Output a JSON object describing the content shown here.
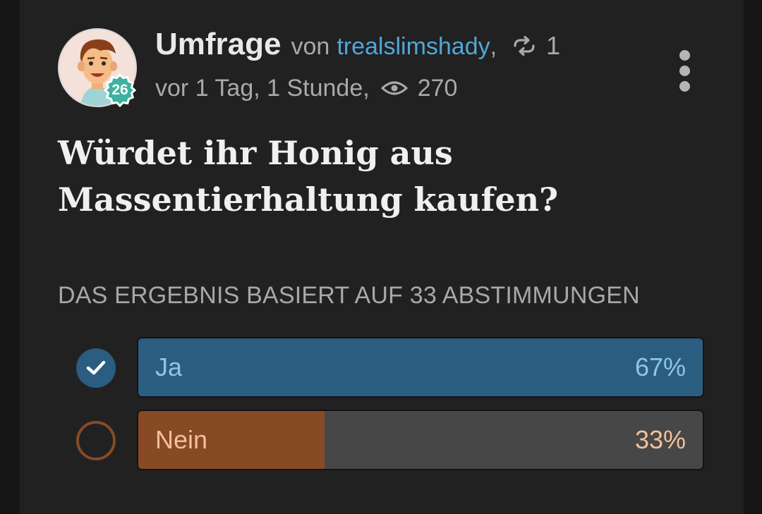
{
  "header": {
    "post_type": "Umfrage",
    "by_text": "von",
    "author": "trealslimshady",
    "comma": ",",
    "repost_count": "1",
    "time": "vor 1 Tag, 1 Stunde,",
    "view_count": "270",
    "level": "26"
  },
  "question": "Würdet ihr Honig aus Massentierhaltung kaufen?",
  "result_summary": "DAS ERGEBNIS BASIERT AUF 33 ABSTIMMUNGEN",
  "options": [
    {
      "label": "Ja",
      "percent_text": "67%",
      "percent": 67,
      "selected": true,
      "fill_color": "#2b5d80",
      "text_color": "#8cc6ea"
    },
    {
      "label": "Nein",
      "percent_text": "33%",
      "percent": 33,
      "selected": false,
      "fill_color": "#874a25",
      "text_color": "#f2c09b"
    }
  ],
  "icons": {
    "repost": "repost-icon",
    "views": "eye-icon",
    "menu": "more-vertical-icon",
    "check": "check-icon"
  }
}
